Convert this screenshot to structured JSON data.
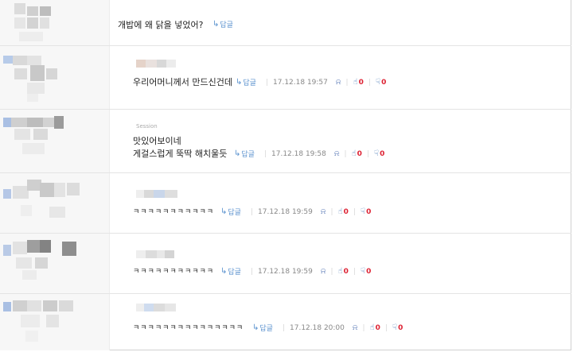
{
  "comments": [
    {
      "text": "개밥에 왜 닭을 넣었어?",
      "reply_label": "답글"
    },
    {
      "text": "우리어머니께서 만드신건데",
      "reply_label": "답글",
      "date": "17.12.18 19:57",
      "up": "0",
      "down": "0"
    },
    {
      "nick": "Session",
      "text_line1": "맛있어보이네",
      "text": "게걸스럽게 뚝딱 해치울듯",
      "reply_label": "답글",
      "date": "17.12.18 19:58",
      "up": "0",
      "down": "0"
    },
    {
      "text": "ㅋㅋㅋㅋㅋㅋㅋㅋㅋㅋㅋ",
      "reply_label": "답글",
      "date": "17.12.18 19:59",
      "up": "0",
      "down": "0"
    },
    {
      "text": "ㅋㅋㅋㅋㅋㅋㅋㅋㅋㅋㅋ",
      "reply_label": "답글",
      "date": "17.12.18 19:59",
      "up": "0",
      "down": "0"
    },
    {
      "text": "ㅋㅋㅋㅋㅋㅋㅋㅋㅋㅋㅋㅋㅋㅋㅋ",
      "reply_label": "답글",
      "date": "17.12.18 20:00",
      "up": "0",
      "down": "0"
    }
  ],
  "icons": {
    "reply": "reply-arrow-icon",
    "report": "bell-icon",
    "thumbs_up": "thumbs-up-icon",
    "thumbs_down": "thumbs-down-icon"
  },
  "colors": {
    "reply_link": "#5c93cf",
    "vote_count": "#dd2233",
    "thumb": "#4a7ab6"
  }
}
